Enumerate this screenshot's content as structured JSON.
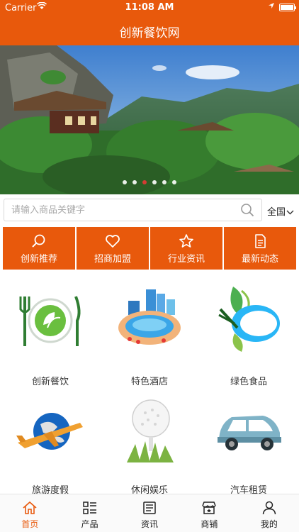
{
  "status_bar": {
    "carrier": "Carrier",
    "time": "11:08 AM"
  },
  "header": {
    "title": "创新餐饮网"
  },
  "banner": {
    "slides": 6,
    "active_slide": 3
  },
  "search": {
    "placeholder": "请输入商品关键字",
    "value": "",
    "region": "全国"
  },
  "quick_nav": [
    {
      "label": "创新推荐",
      "icon": "search-icon"
    },
    {
      "label": "招商加盟",
      "icon": "heart-icon"
    },
    {
      "label": "行业资讯",
      "icon": "star-icon"
    },
    {
      "label": "最新动态",
      "icon": "document-icon"
    }
  ],
  "categories": [
    {
      "label": "创新餐饮",
      "icon": "plate-fork-knife-icon"
    },
    {
      "label": "特色酒店",
      "icon": "hotel-pool-icon"
    },
    {
      "label": "绿色食品",
      "icon": "green-food-icon"
    },
    {
      "label": "旅游度假",
      "icon": "airplane-globe-icon"
    },
    {
      "label": "休闲娱乐",
      "icon": "golf-ball-icon"
    },
    {
      "label": "汽车租赁",
      "icon": "car-icon"
    }
  ],
  "tabbar": [
    {
      "label": "首页",
      "icon": "home-icon",
      "active": true
    },
    {
      "label": "产品",
      "icon": "grid-list-icon",
      "active": false
    },
    {
      "label": "资讯",
      "icon": "news-icon",
      "active": false
    },
    {
      "label": "商铺",
      "icon": "store-icon",
      "active": false
    },
    {
      "label": "我的",
      "icon": "user-icon",
      "active": false
    }
  ],
  "colors": {
    "brand": "#e8590c",
    "active_dot": "#e53935"
  }
}
